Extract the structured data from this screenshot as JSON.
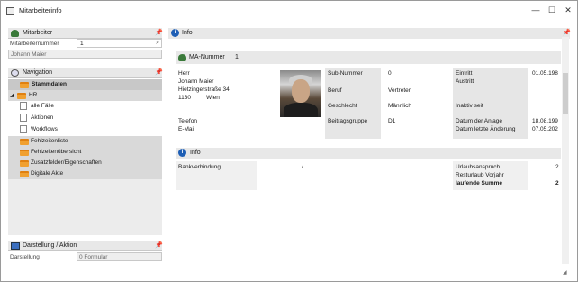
{
  "window": {
    "title": "Mitarbeiterinfo",
    "minimize": "—",
    "maximize": "☐",
    "close": "✕"
  },
  "mitarbeiter": {
    "header": "Mitarbeiter",
    "nummer_label": "Mitarbeiternummer",
    "nummer_value": "1",
    "name": "Johann Maier"
  },
  "navigation": {
    "header": "Navigation",
    "items": [
      {
        "label": "Stammdaten"
      },
      {
        "label": "HR"
      },
      {
        "label": "alle Fälle"
      },
      {
        "label": "Aktionen"
      },
      {
        "label": "Workflows"
      },
      {
        "label": "Fehlzeitenliste"
      },
      {
        "label": "Fehlzeitenübersicht"
      },
      {
        "label": "Zusatzfelder/Eigenschaften"
      },
      {
        "label": "Digitale Akte"
      }
    ]
  },
  "darstellung": {
    "header": "Darstellung / Aktion",
    "label": "Darstellung",
    "value": "0 Formular"
  },
  "info": {
    "header": "Info",
    "ma_nummer_label": "MA-Nummer",
    "ma_nummer_value": "1",
    "anrede": "Herr",
    "name": "Johann Maier",
    "strasse": "Hietzingerstraße 34",
    "plz": "1130",
    "ort": "Wien",
    "telefon_label": "Telefon",
    "email_label": "E-Mail",
    "sub_nummer_label": "Sub-Nummer",
    "sub_nummer_value": "0",
    "beruf_label": "Beruf",
    "beruf_value": "Vertreter",
    "geschlecht_label": "Geschlecht",
    "geschlecht_value": "Männlich",
    "beitragsgruppe_label": "Beitragsgruppe",
    "beitragsgruppe_value": "D1",
    "eintritt_label": "Eintritt",
    "eintritt_value": "01.05.198",
    "austritt_label": "Austritt",
    "inaktiv_label": "Inaktiv seit",
    "anlage_label": "Datum der Anlage",
    "anlage_value": "18.08.199",
    "aenderung_label": "Datum letzte Änderung",
    "aenderung_value": "07.05.202"
  },
  "info2": {
    "header": "Info",
    "bank_label": "Bankverbindung",
    "bank_value": "/",
    "urlaub_label": "Urlaubsanspruch",
    "urlaub_value": "2",
    "rest_label": "Resturlaub Vorjahr",
    "rest_value": "",
    "summe_label": "laufende Summe",
    "summe_value": "2"
  },
  "colors": {
    "accent": "#1f5fb5",
    "folder": "#f0a030",
    "selection": "#c8c8c8"
  }
}
